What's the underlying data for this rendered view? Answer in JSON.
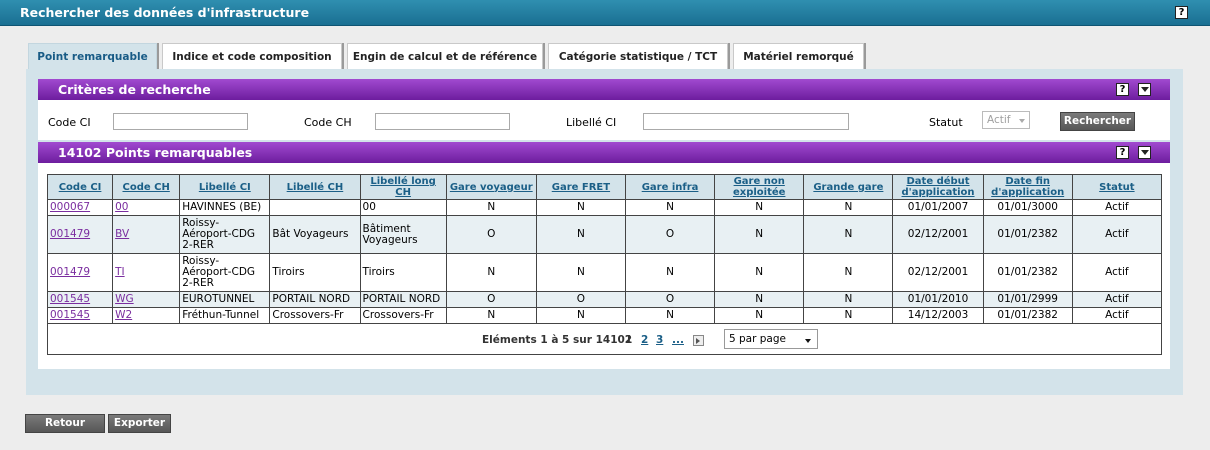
{
  "window": {
    "title": "Rechercher des données d'infrastructure",
    "help_label": "?"
  },
  "tabs": [
    {
      "label": "Point remarquable",
      "active": true
    },
    {
      "label": "Indice et code composition",
      "active": false
    },
    {
      "label": "Engin de calcul et de référence",
      "active": false
    },
    {
      "label": "Catégorie statistique / TCT",
      "active": false
    },
    {
      "label": "Matériel remorqué",
      "active": false
    }
  ],
  "criteria": {
    "title": "Critères de recherche",
    "fields": [
      {
        "label": "Code CI",
        "value": ""
      },
      {
        "label": "Code CH",
        "value": ""
      },
      {
        "label": "Libellé CI",
        "value": ""
      }
    ],
    "status": {
      "label": "Statut",
      "value": "Actif"
    },
    "search_button": "Rechercher"
  },
  "results": {
    "title": "14102 Points remarquables",
    "columns": [
      "Code CI",
      "Code CH",
      "Libellé CI",
      "Libellé CH",
      "Libellé long CH",
      "Gare voyageur",
      "Gare FRET",
      "Gare infra",
      "Gare non exploitée",
      "Grande gare",
      "Date début d'application",
      "Date fin d'application",
      "Statut"
    ],
    "rows": [
      [
        "000067",
        "00",
        "HAVINNES (BE)",
        "",
        "00",
        "N",
        "N",
        "N",
        "N",
        "N",
        "01/01/2007",
        "01/01/3000",
        "Actif"
      ],
      [
        "001479",
        "BV",
        "Roissy-Aéroport-CDG 2-RER",
        "Bât Voyageurs",
        "Bâtiment Voyageurs",
        "O",
        "N",
        "O",
        "N",
        "N",
        "02/12/2001",
        "01/01/2382",
        "Actif"
      ],
      [
        "001479",
        "TI",
        "Roissy-Aéroport-CDG 2-RER",
        "Tiroirs",
        "Tiroirs",
        "N",
        "N",
        "N",
        "N",
        "N",
        "02/12/2001",
        "01/01/2382",
        "Actif"
      ],
      [
        "001545",
        "WG",
        "EUROTUNNEL",
        "PORTAIL NORD",
        "PORTAIL NORD",
        "O",
        "O",
        "O",
        "N",
        "N",
        "01/01/2010",
        "01/01/2999",
        "Actif"
      ],
      [
        "001545",
        "W2",
        "Fréthun-Tunnel",
        "Crossovers-Fr",
        "Crossovers-Fr",
        "N",
        "N",
        "N",
        "N",
        "N",
        "14/12/2003",
        "01/01/2382",
        "Actif"
      ]
    ],
    "pagination": {
      "summary": "Eléments 1 à 5 sur 14102",
      "current": "1",
      "pages": [
        "2",
        "3",
        "..."
      ],
      "per_page": "5 par page"
    }
  },
  "footer": {
    "back_button": "Retour",
    "export_button": "Exporter"
  },
  "colors": {
    "titlebar": "#2f8fb0",
    "section_header": "#8a33bd",
    "panel": "#d3e3ea",
    "link": "#7a2d9f"
  }
}
